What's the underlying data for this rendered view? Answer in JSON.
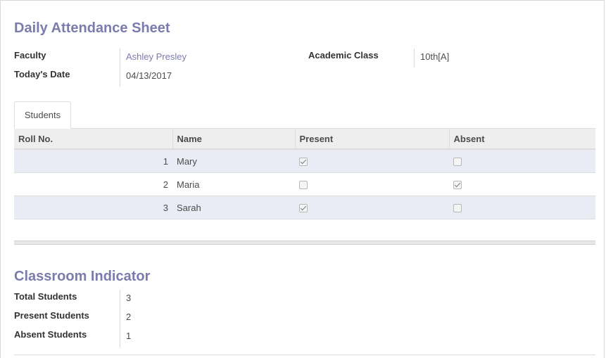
{
  "sheet": {
    "title": "Daily Attendance Sheet",
    "faculty_label": "Faculty",
    "faculty_value": "Ashley Presley",
    "date_label": "Today's Date",
    "date_value": "04/13/2017",
    "class_label": "Academic Class",
    "class_value": "10th[A]"
  },
  "tabs": [
    {
      "label": "Students"
    }
  ],
  "table": {
    "headers": [
      "Roll No.",
      "Name",
      "Present",
      "Absent"
    ],
    "rows": [
      {
        "roll": "1",
        "name": "Mary",
        "present": true,
        "absent": false
      },
      {
        "roll": "2",
        "name": "Maria",
        "present": false,
        "absent": true
      },
      {
        "roll": "3",
        "name": "Sarah",
        "present": true,
        "absent": false
      }
    ]
  },
  "indicator": {
    "title": "Classroom Indicator",
    "total_label": "Total Students",
    "total_value": "3",
    "present_label": "Present Students",
    "present_value": "2",
    "absent_label": "Absent Students",
    "absent_value": "1"
  }
}
